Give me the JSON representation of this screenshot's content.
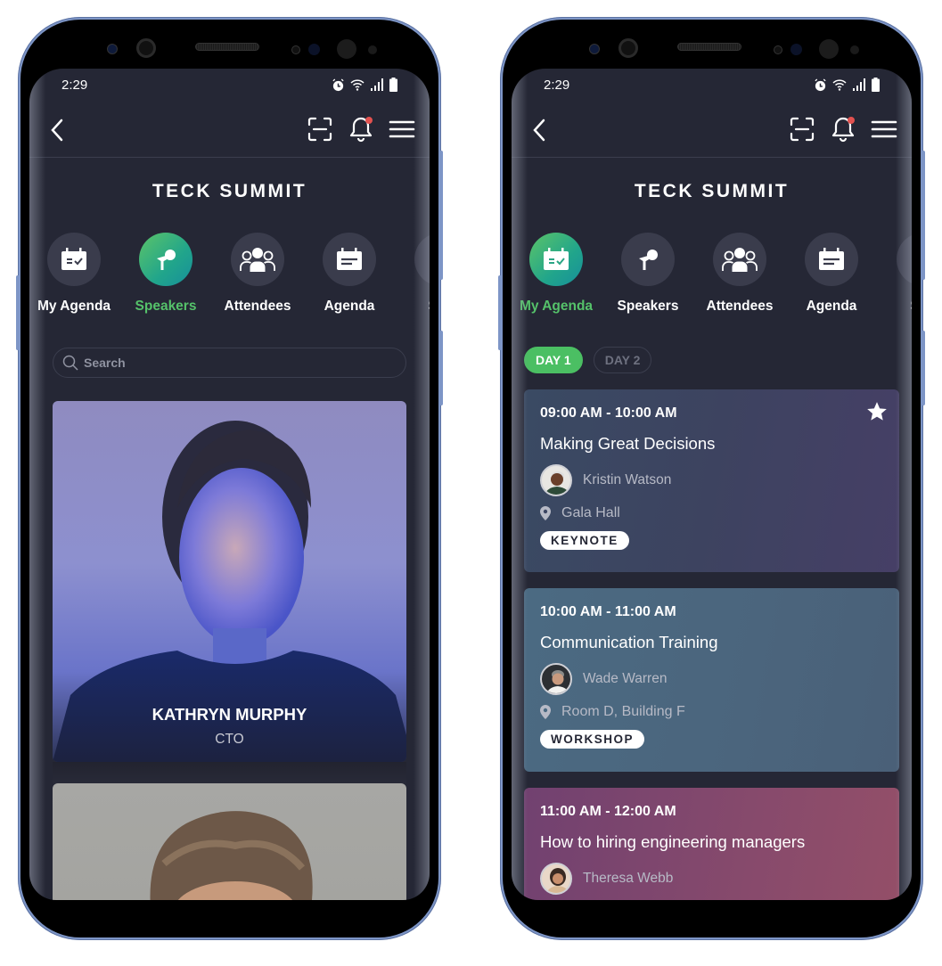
{
  "status_bar": {
    "time": "2:29",
    "icons": [
      "alarm-icon",
      "wifi-icon",
      "signal-icon",
      "battery-icon"
    ]
  },
  "app_bar": {
    "back_icon": "chevron-left-icon",
    "actions": [
      "scan-icon",
      "bell-icon",
      "menu-icon"
    ],
    "has_notification": true
  },
  "event": {
    "title": "TECK SUMMIT"
  },
  "nav_items": [
    {
      "label": "My Agenda",
      "icon": "calendar-check-icon"
    },
    {
      "label": "Speakers",
      "icon": "microphone-icon"
    },
    {
      "label": "Attendees",
      "icon": "people-icon"
    },
    {
      "label": "Agenda",
      "icon": "calendar-list-icon"
    },
    {
      "label": "Spo",
      "icon": "sponsors-icon"
    }
  ],
  "colors": {
    "accent": "#55c26a",
    "background": "#252735",
    "notification": "#e2514f"
  },
  "speakers_screen": {
    "active_nav": "Speakers",
    "search": {
      "placeholder": "Search",
      "value": ""
    },
    "speakers": [
      {
        "name": "KATHRYN MURPHY",
        "role": "CTO"
      },
      {
        "name": "",
        "role": ""
      }
    ]
  },
  "agenda_screen": {
    "active_nav": "My Agenda",
    "day_tabs": [
      {
        "label": "DAY 1",
        "active": true
      },
      {
        "label": "DAY 2",
        "active": false
      }
    ],
    "sessions": [
      {
        "time": "09:00 AM - 10:00 AM",
        "title": "Making Great Decisions",
        "speaker": "Kristin Watson",
        "location": "Gala Hall",
        "tag": "KEYNOTE",
        "starred": true
      },
      {
        "time": "10:00 AM - 11:00 AM",
        "title": "Communication Training",
        "speaker": "Wade Warren",
        "location": "Room D, Building F",
        "tag": "WORKSHOP",
        "starred": false
      },
      {
        "time": "11:00 AM - 12:00 AM",
        "title": "How to hiring engineering managers",
        "speaker": "Theresa Webb",
        "location": "",
        "tag": "",
        "starred": false
      }
    ]
  }
}
